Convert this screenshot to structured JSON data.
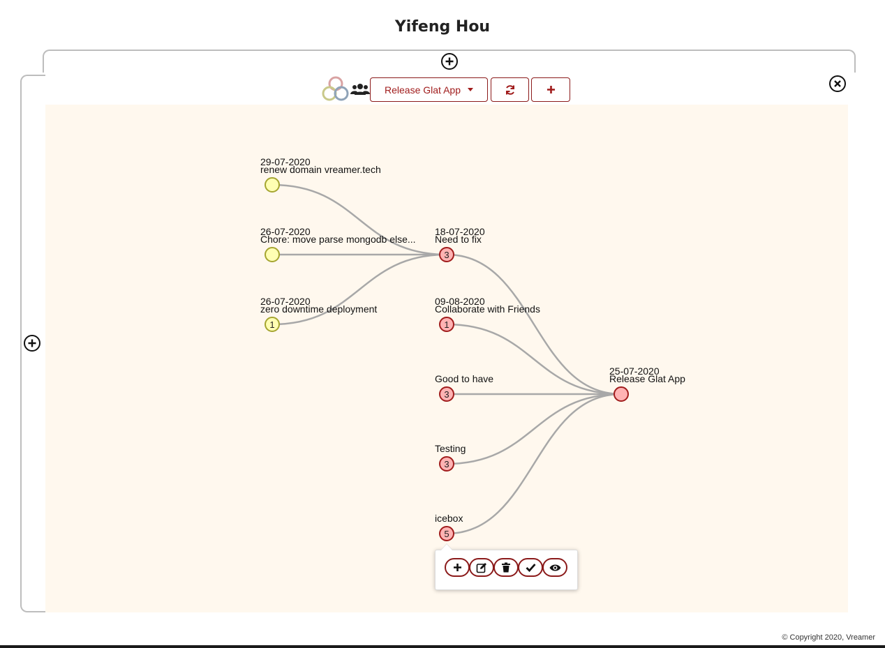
{
  "page": {
    "title": "Yifeng Hou"
  },
  "toolbar": {
    "goal_select_label": "Release Glat App",
    "logo_icon": "venn-circles-icon",
    "users_icon": "users-icon",
    "refresh_icon": "refresh-icon",
    "add_icon": "plus-icon"
  },
  "panels": {
    "expand_top_icon": "plus-circle-icon",
    "expand_left_icon": "plus-circle-icon",
    "close_icon": "close-circle-icon"
  },
  "nodes": [
    {
      "id": "renew-domain",
      "date": "29-07-2020",
      "label": "renew domain vreamer.tech",
      "count": "",
      "color": "yellow"
    },
    {
      "id": "chore-mongodb",
      "date": "26-07-2020",
      "label": "Chore: move parse mongodb else...",
      "count": "",
      "color": "yellow"
    },
    {
      "id": "zero-downtime",
      "date": "26-07-2020",
      "label": "zero downtime deployment",
      "count": "1",
      "color": "yellow"
    },
    {
      "id": "need-to-fix",
      "date": "18-07-2020",
      "label": "Need to fix",
      "count": "3",
      "color": "red"
    },
    {
      "id": "collaborate",
      "date": "09-08-2020",
      "label": "Collaborate with Friends",
      "count": "1",
      "color": "red"
    },
    {
      "id": "good-to-have",
      "date": "",
      "label": "Good to have",
      "count": "3",
      "color": "red"
    },
    {
      "id": "testing",
      "date": "",
      "label": "Testing",
      "count": "3",
      "color": "red"
    },
    {
      "id": "icebox",
      "date": "",
      "label": "icebox",
      "count": "5",
      "color": "red"
    },
    {
      "id": "release-glat",
      "date": "25-07-2020",
      "label": "Release Glat App",
      "count": "",
      "color": "red"
    }
  ],
  "edges": [
    {
      "from": "renew-domain",
      "to": "need-to-fix"
    },
    {
      "from": "chore-mongodb",
      "to": "need-to-fix"
    },
    {
      "from": "zero-downtime",
      "to": "need-to-fix"
    },
    {
      "from": "need-to-fix",
      "to": "release-glat"
    },
    {
      "from": "collaborate",
      "to": "release-glat"
    },
    {
      "from": "good-to-have",
      "to": "release-glat"
    },
    {
      "from": "testing",
      "to": "release-glat"
    },
    {
      "from": "icebox",
      "to": "release-glat"
    }
  ],
  "node_popup": {
    "actions": [
      {
        "name": "add",
        "icon": "plus-icon"
      },
      {
        "name": "edit",
        "icon": "edit-icon"
      },
      {
        "name": "delete",
        "icon": "trash-icon"
      },
      {
        "name": "complete",
        "icon": "check-icon"
      },
      {
        "name": "view",
        "icon": "eye-icon"
      }
    ]
  },
  "colors": {
    "accent": "#a01c1c",
    "node_red": "#ffb3b3",
    "node_yellow": "#ffffb3",
    "canvas_bg": "#fff8ee",
    "edge": "#a8a8a8"
  },
  "footer": {
    "copyright": "© Copyright 2020, Vreamer"
  }
}
